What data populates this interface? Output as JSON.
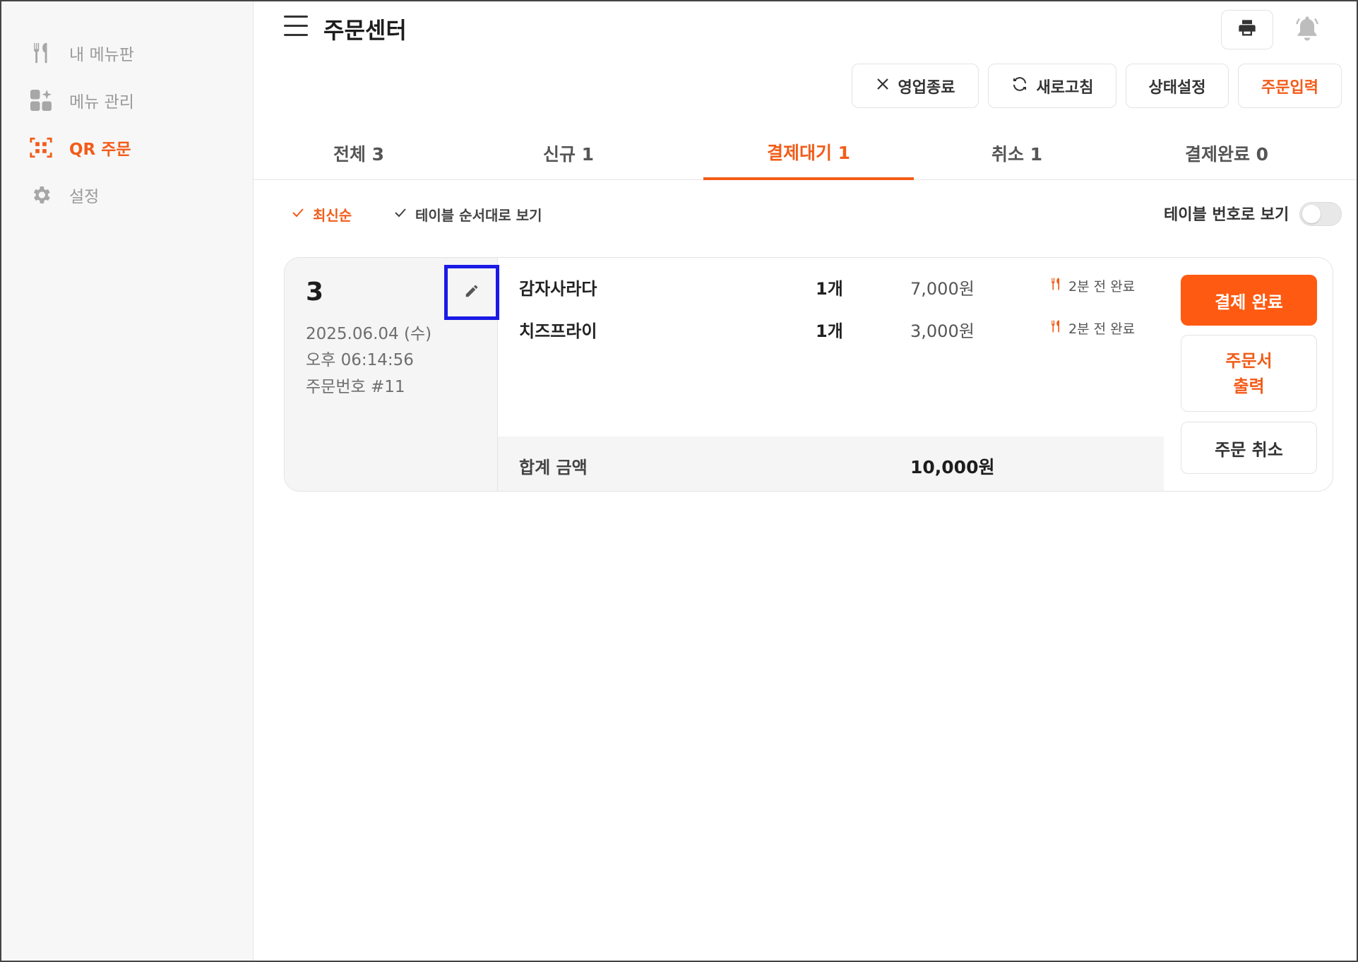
{
  "sidebar": {
    "items": [
      {
        "label": "내 메뉴판",
        "icon": "utensils-icon",
        "active": false
      },
      {
        "label": "메뉴 관리",
        "icon": "grid-sparkle-icon",
        "active": false
      },
      {
        "label": "QR 주문",
        "icon": "qr-scan-icon",
        "active": true
      },
      {
        "label": "설정",
        "icon": "gear-icon",
        "active": false
      }
    ]
  },
  "header": {
    "title": "주문센터",
    "menu_icon": "hamburger-icon",
    "print_icon": "printer-icon",
    "bell_icon": "bell-icon"
  },
  "toolbar": {
    "close_business": "영업종료",
    "refresh": "새로고침",
    "status_setting": "상태설정",
    "order_input": "주문입력"
  },
  "tabs": [
    {
      "label": "전체 3"
    },
    {
      "label": "신규 1"
    },
    {
      "label": "결제대기 1",
      "active": true
    },
    {
      "label": "취소 1"
    },
    {
      "label": "결제완료 0"
    }
  ],
  "filters": {
    "latest": "최신순",
    "table_order": "테이블 순서대로 보기",
    "toggle_label": "테이블 번호로 보기",
    "toggle_on": false
  },
  "order": {
    "table_no": "3",
    "date": "2025.06.04 (수)",
    "time": "오후 06:14:56",
    "order_no": "주문번호 #11",
    "items": [
      {
        "name": "감자사라다",
        "qty": "1개",
        "price": "7,000원",
        "status": "2분 전 완료"
      },
      {
        "name": "치즈프라이",
        "qty": "1개",
        "price": "3,000원",
        "status": "2분 전 완료"
      }
    ],
    "total_label": "합계 금액",
    "total": "10,000원",
    "actions": {
      "pay_complete": "결제 완료",
      "print_line1": "주문서",
      "print_line2": "출력",
      "cancel": "주문 취소"
    }
  },
  "colors": {
    "accent": "#f25c19",
    "primary_button": "#fe5a11",
    "sidebar_bg": "#f7f7f7",
    "highlight_box": "#1a1ae6"
  }
}
